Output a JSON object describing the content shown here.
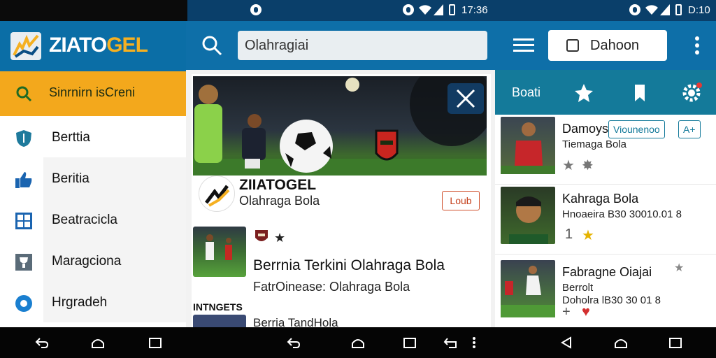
{
  "status_bar": {
    "time_mid": "17:36",
    "time_right": "D:10"
  },
  "brand": {
    "name_part1": "ZIATO",
    "name_part2": "GEL",
    "colors": {
      "primary": "#0b6ea6",
      "accent": "#f5b021"
    }
  },
  "left_panel": {
    "search_label": "Sinrnirn isCreni",
    "nav_items": [
      {
        "label": "Berttia",
        "icon": "shield-icon"
      },
      {
        "label": "Beritia",
        "icon": "thumbs-up-icon"
      },
      {
        "label": "Beatracicla",
        "icon": "grid-icon"
      },
      {
        "label": "Maragciona",
        "icon": "trophy-icon"
      },
      {
        "label": "Hrgradeh",
        "icon": "circle-icon"
      }
    ]
  },
  "middle_panel": {
    "search_value": "Olahragiai",
    "publisher": {
      "name": "ZIIATOGEL",
      "subtitle": "Olahraga Bola",
      "follow_label": "Loub"
    },
    "article": {
      "title": "Berrnia Terkini Olahraga Bola",
      "meta": "FatrOinease: Olahraga Bola"
    },
    "section_heading": "INTNGETS",
    "article2_title": "Berria TandHola"
  },
  "right_panel": {
    "donate_label": "Dahoon",
    "tab_label": "Boati",
    "items": [
      {
        "title": "Damoys",
        "meta1": "Tiemaga Bola",
        "follow_label": "Viounenoo",
        "add_label": "A+"
      },
      {
        "title": "Kahraga Bola",
        "meta1": "Hnoaeira B30 30010.01 8",
        "count": "1"
      },
      {
        "title": "Fabragne Oiajai",
        "meta1": "Berrolt",
        "meta2": "Doholra lB30 30 01 8",
        "count": "+"
      }
    ]
  }
}
